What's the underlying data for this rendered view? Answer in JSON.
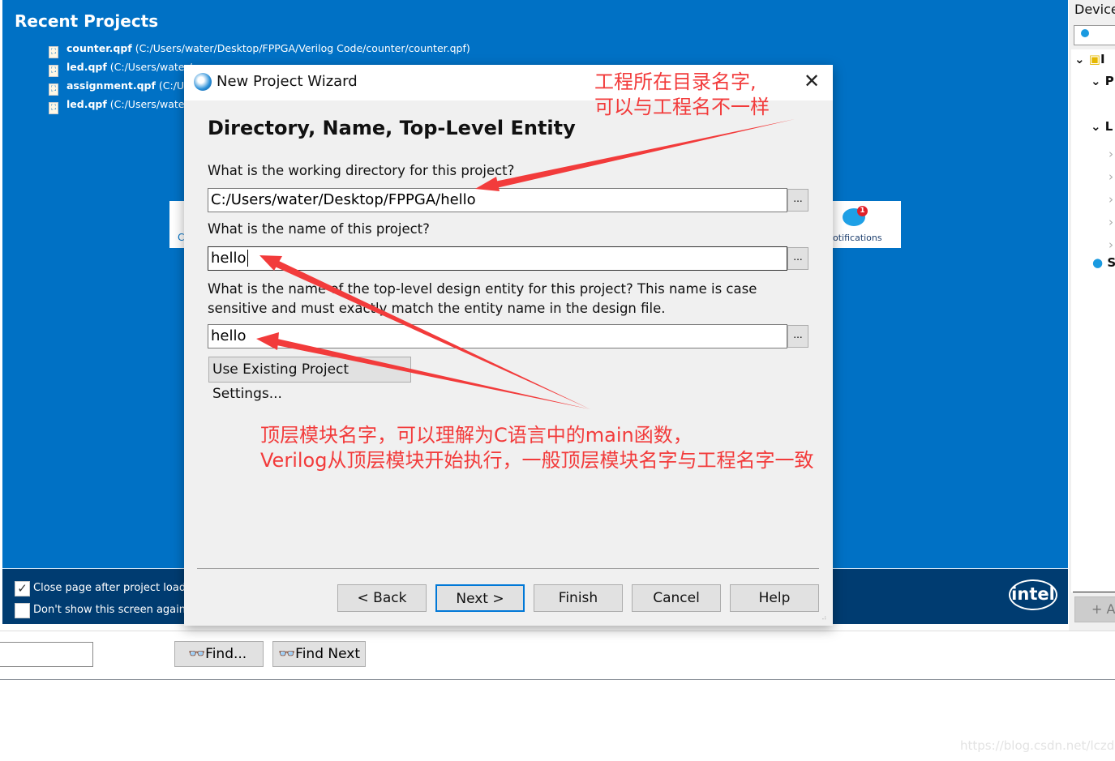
{
  "home": {
    "recent_title": "Recent Projects",
    "recent": [
      {
        "name": "counter.qpf",
        "path": "(C:/Users/water/Desktop/FPPGA/Verilog Code/counter/counter.qpf)"
      },
      {
        "name": "led.qpf",
        "path": "(C:/Users/water/"
      },
      {
        "name": "assignment.qpf",
        "path": "(C:/User"
      },
      {
        "name": "led.qpf",
        "path": "(C:/Users/water/"
      }
    ],
    "left_tile_text": "C",
    "notifications_label": "otifications",
    "notifications_count": "1",
    "close_after_load": {
      "label": "Close page after project load",
      "checked": true
    },
    "dont_show": {
      "label": "Don't show this screen again",
      "checked": false
    },
    "logo": "intel"
  },
  "dialog": {
    "title": "New Project Wizard",
    "heading": "Directory, Name, Top-Level Entity",
    "q_dir": "What is the working directory for this project?",
    "dir_value": "C:/Users/water/Desktop/FPPGA/hello",
    "q_name": "What is the name of this project?",
    "name_value": "hello",
    "q_top": "What is the name of the top-level design entity for this project? This name is case sensitive and must exactly match the entity name in the design file.",
    "top_value": "hello",
    "browse": "...",
    "use_existing": "Use Existing Project Settings...",
    "buttons": {
      "back": "< Back",
      "next": "Next >",
      "finish": "Finish",
      "cancel": "Cancel",
      "help": "Help"
    }
  },
  "annotations": {
    "dir_note_1": "工程所在目录名字,",
    "dir_note_2": "可以与工程名不一样",
    "top_note_1": "顶层模块名字，可以理解为C语言中的main函数，",
    "top_note_2": "Verilog从顶层模块开始执行，一般顶层模块名字与工程名字一致",
    "color": "#f23b3b"
  },
  "right": {
    "title": "Device",
    "tree": [
      "I",
      "P",
      "L",
      "S"
    ],
    "add": "+ A"
  },
  "bottom": {
    "find": "Find...",
    "find_next": "Find Next",
    "find_value": ""
  },
  "watermark": "https://blog.csdn.net/lczdk"
}
